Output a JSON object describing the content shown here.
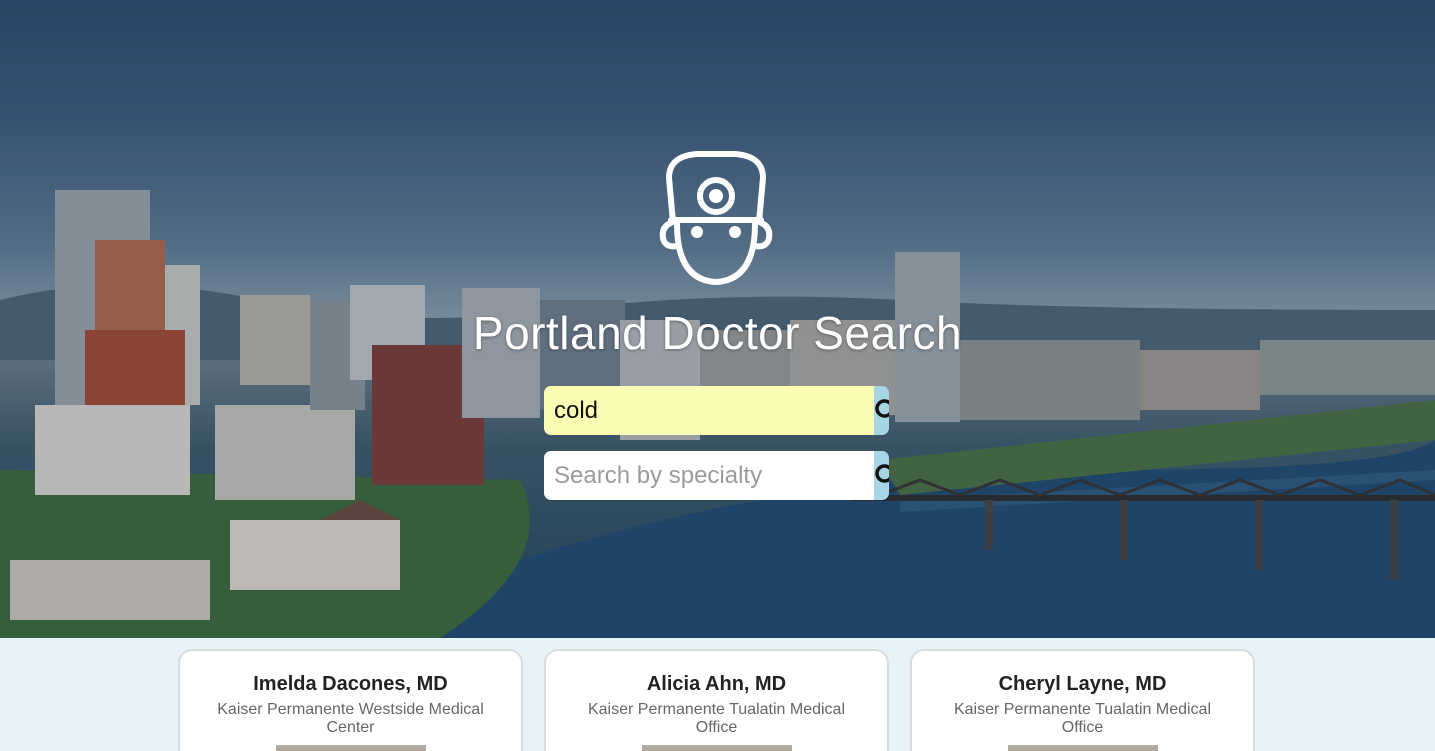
{
  "app": {
    "title": "Portland Doctor Search"
  },
  "search": {
    "condition_value": "cold",
    "condition_placeholder": "",
    "specialty_value": "",
    "specialty_placeholder": "Search by specialty"
  },
  "icons": {
    "logo": "doctor-head-mirror-icon",
    "search": "search-icon"
  },
  "colors": {
    "search_highlight": "#fbfdb4",
    "search_button": "#a6d6e6",
    "results_background": "#e8f3f7"
  },
  "doctors": [
    {
      "name": "Imelda Dacones, MD",
      "facility": "Kaiser Permanente Westside Medical Center"
    },
    {
      "name": "Alicia Ahn, MD",
      "facility": "Kaiser Permanente Tualatin Medical Office"
    },
    {
      "name": "Cheryl Layne, MD",
      "facility": "Kaiser Permanente Tualatin Medical Office"
    }
  ]
}
